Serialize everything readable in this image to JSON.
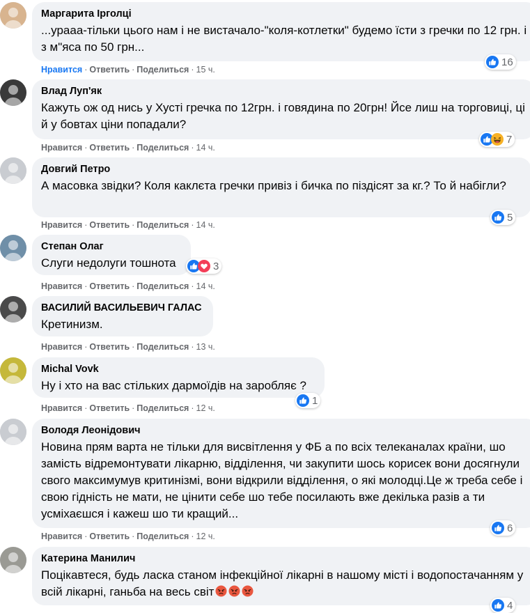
{
  "actions": {
    "like": "Нравится",
    "reply": "Ответить",
    "share": "Поделиться"
  },
  "colors": {
    "bubble": "#f0f2f5",
    "meta": "#65676b",
    "like_blue": "#1877f2",
    "love_red": "#f33e58",
    "haha_yellow": "#f7b125"
  },
  "comments": [
    {
      "author": "Маргарита Ірголці",
      "text": "...урааа-тільки цього нам і не вистачало-\"коля-котлетки\" будемо їсти з гречки по 12 грн. і з м\"яса по 50 грн...",
      "time": "15 ч.",
      "reaction_count": "16",
      "reactions": [
        "like-icon"
      ],
      "like_active": true
    },
    {
      "author": "Влад Луп'як",
      "text": "Кажуть ож од нись у Хусті гречка по 12грн. і говядина по 20грн! Йсе лиш на торговиці, ці й у бовтах ціни попадали?",
      "time": "14 ч.",
      "reaction_count": "7",
      "reactions": [
        "like-icon",
        "haha-icon"
      ]
    },
    {
      "author": "Довгий Петро",
      "text": "А масовка звідки? Коля каклєта гречки привіз і бичка по піздісят за кг.? То й набігли?",
      "time": "14 ч.",
      "reaction_count": "5",
      "reactions": [
        "like-icon"
      ]
    },
    {
      "author": "Степан Олаг",
      "text": "Слуги недолуги тошнота",
      "time": "14 ч.",
      "reaction_count": "3",
      "reactions": [
        "like-icon",
        "love-icon"
      ]
    },
    {
      "author": "ВАСИЛИЙ ВАСИЛЬЕВИЧ ГАЛАС",
      "text": "Кретинизм.",
      "time": "13 ч."
    },
    {
      "author": "Michal Vovk",
      "text": "Ну і хто на вас стільких дармоїдів на заробляє ?",
      "time": "12 ч.",
      "reaction_count": "1",
      "reactions": [
        "like-icon"
      ]
    },
    {
      "author": "Володя Леонідович",
      "text": "Новина прям варта не тільки для висвітлення у ФБ а по всіх телеканалах країни, шо замість відремонтувати лікарню, відділення, чи закупити шось корисек вони досягнули свого максимумув критинізмі, вони відкрили відділення, о які молодці.Це ж треба себе і свою гідність не мати, не цінити себе шо тебе посилають вже декілька разів а ти усміхаєшся і кажеш шо ти кращий...",
      "time": "12 ч.",
      "reaction_count": "6",
      "reactions": [
        "like-icon"
      ]
    },
    {
      "author": "Катерина Манилич",
      "text": "Поцікавтеся, будь ласка станом інфекційної лікарні в нашому місті і водопостачанням у всій лікарні, ганьба на весь світ",
      "emojis": [
        "angry-face-icon",
        "angry-face-icon",
        "angry-face-icon"
      ],
      "reaction_count": "4",
      "reactions": [
        "like-icon"
      ]
    }
  ]
}
